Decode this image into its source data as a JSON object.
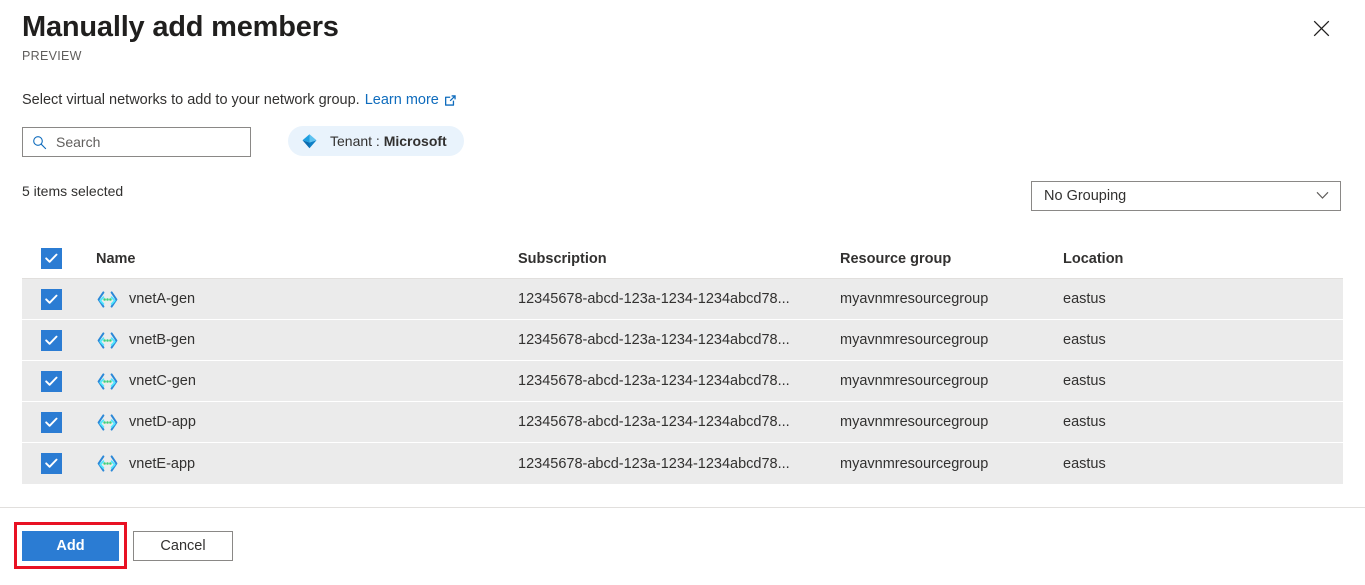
{
  "header": {
    "title": "Manually add members",
    "preview_tag": "PREVIEW",
    "close_icon": "close-icon"
  },
  "subtitle": {
    "text": "Select virtual networks to add to your network group.",
    "link_label": "Learn more",
    "link_icon": "external-link-icon"
  },
  "filters": {
    "search": {
      "placeholder": "Search",
      "value": "",
      "icon": "search-icon"
    },
    "tenant_pill": {
      "prefix": "Tenant : ",
      "value": "Microsoft",
      "icon": "azure-tenant-diamond-icon",
      "background": "#e9f3fc"
    }
  },
  "toolbar": {
    "selection_summary": "5 items selected",
    "grouping": {
      "selected": "No Grouping",
      "icon": "chevron-down-icon"
    }
  },
  "table": {
    "select_all_checked": true,
    "columns": {
      "name": "Name",
      "subscription": "Subscription",
      "resource_group": "Resource group",
      "location": "Location"
    },
    "rows": [
      {
        "checked": true,
        "icon": "virtual-network-icon",
        "name": "vnetA-gen",
        "subscription": "12345678-abcd-123a-1234-1234abcd78...",
        "resource_group": "myavnmresourcegroup",
        "location": "eastus"
      },
      {
        "checked": true,
        "icon": "virtual-network-icon",
        "name": "vnetB-gen",
        "subscription": "12345678-abcd-123a-1234-1234abcd78...",
        "resource_group": "myavnmresourcegroup",
        "location": "eastus"
      },
      {
        "checked": true,
        "icon": "virtual-network-icon",
        "name": "vnetC-gen",
        "subscription": "12345678-abcd-123a-1234-1234abcd78...",
        "resource_group": "myavnmresourcegroup",
        "location": "eastus"
      },
      {
        "checked": true,
        "icon": "virtual-network-icon",
        "name": "vnetD-app",
        "subscription": "12345678-abcd-123a-1234-1234abcd78...",
        "resource_group": "myavnmresourcegroup",
        "location": "eastus"
      },
      {
        "checked": true,
        "icon": "virtual-network-icon",
        "name": "vnetE-app",
        "subscription": "12345678-abcd-123a-1234-1234abcd78...",
        "resource_group": "myavnmresourcegroup",
        "location": "eastus"
      }
    ]
  },
  "footer": {
    "add_label": "Add",
    "cancel_label": "Cancel"
  },
  "colors": {
    "accent_blue": "#2b7cd3",
    "link_blue": "#0f6cbd",
    "row_background": "#ebebeb",
    "highlight_red": "#e81123"
  }
}
